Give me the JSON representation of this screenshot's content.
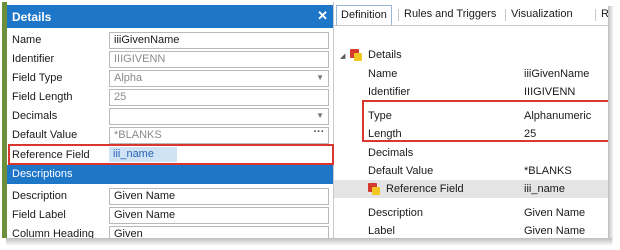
{
  "details": {
    "header": "Details",
    "close": "✕",
    "fields": [
      {
        "label": "Name",
        "value": "iiiGivenName"
      },
      {
        "label": "Identifier",
        "value": "IIIGIVENN"
      },
      {
        "label": "Field Type",
        "value": "Alpha"
      },
      {
        "label": "Field Length",
        "value": "25"
      },
      {
        "label": "Decimals",
        "value": ""
      },
      {
        "label": "Default Value",
        "value": "*BLANKS",
        "button": "···"
      },
      {
        "label": "Reference Field",
        "value": "iii_name"
      }
    ],
    "descriptions_header": "Descriptions",
    "descriptions": [
      {
        "label": "Description",
        "value": "Given Name"
      },
      {
        "label": "Field Label",
        "value": "Given Name"
      },
      {
        "label": "Column Heading",
        "value": "Given"
      }
    ]
  },
  "tabs": [
    "Definition",
    "Rules and Triggers",
    "Visualization",
    "Repository Help"
  ],
  "tree": {
    "root": "Details",
    "rows": [
      {
        "k": "Name",
        "v": "iiiGivenName"
      },
      {
        "k": "Identifier",
        "v": "IIIGIVENN"
      },
      {
        "k": "Type",
        "v": "Alphanumeric"
      },
      {
        "k": "Length",
        "v": "25"
      },
      {
        "k": "Decimals",
        "v": ""
      },
      {
        "k": "Default Value",
        "v": "*BLANKS"
      },
      {
        "k": "Reference Field",
        "v": "iii_name"
      },
      {
        "k": "Description",
        "v": "Given Name"
      },
      {
        "k": "Label",
        "v": "Given Name"
      }
    ]
  },
  "colors": {
    "accent": "#1e76c9",
    "highlight": "#d9362f"
  }
}
